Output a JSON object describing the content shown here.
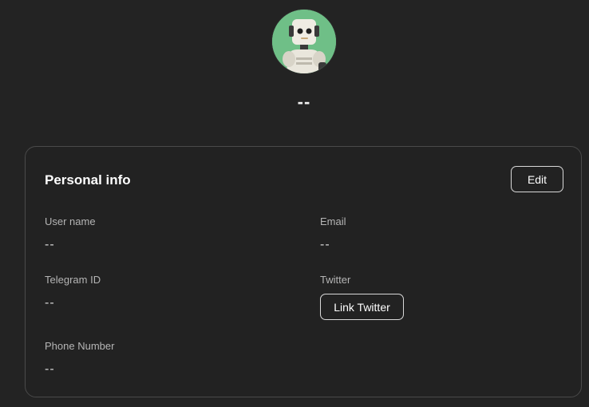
{
  "profile": {
    "display_name": "--"
  },
  "personal_info": {
    "title": "Personal info",
    "edit_label": "Edit",
    "fields": {
      "username": {
        "label": "User name",
        "value": "--"
      },
      "email": {
        "label": "Email",
        "value": "--"
      },
      "telegram": {
        "label": "Telegram ID",
        "value": "--"
      },
      "twitter": {
        "label": "Twitter",
        "button_label": "Link Twitter"
      },
      "phone": {
        "label": "Phone Number",
        "value": "--"
      }
    }
  },
  "colors": {
    "background": "#232323",
    "avatar_bg": "#6fbf87",
    "card_border": "#4a4a4a"
  }
}
